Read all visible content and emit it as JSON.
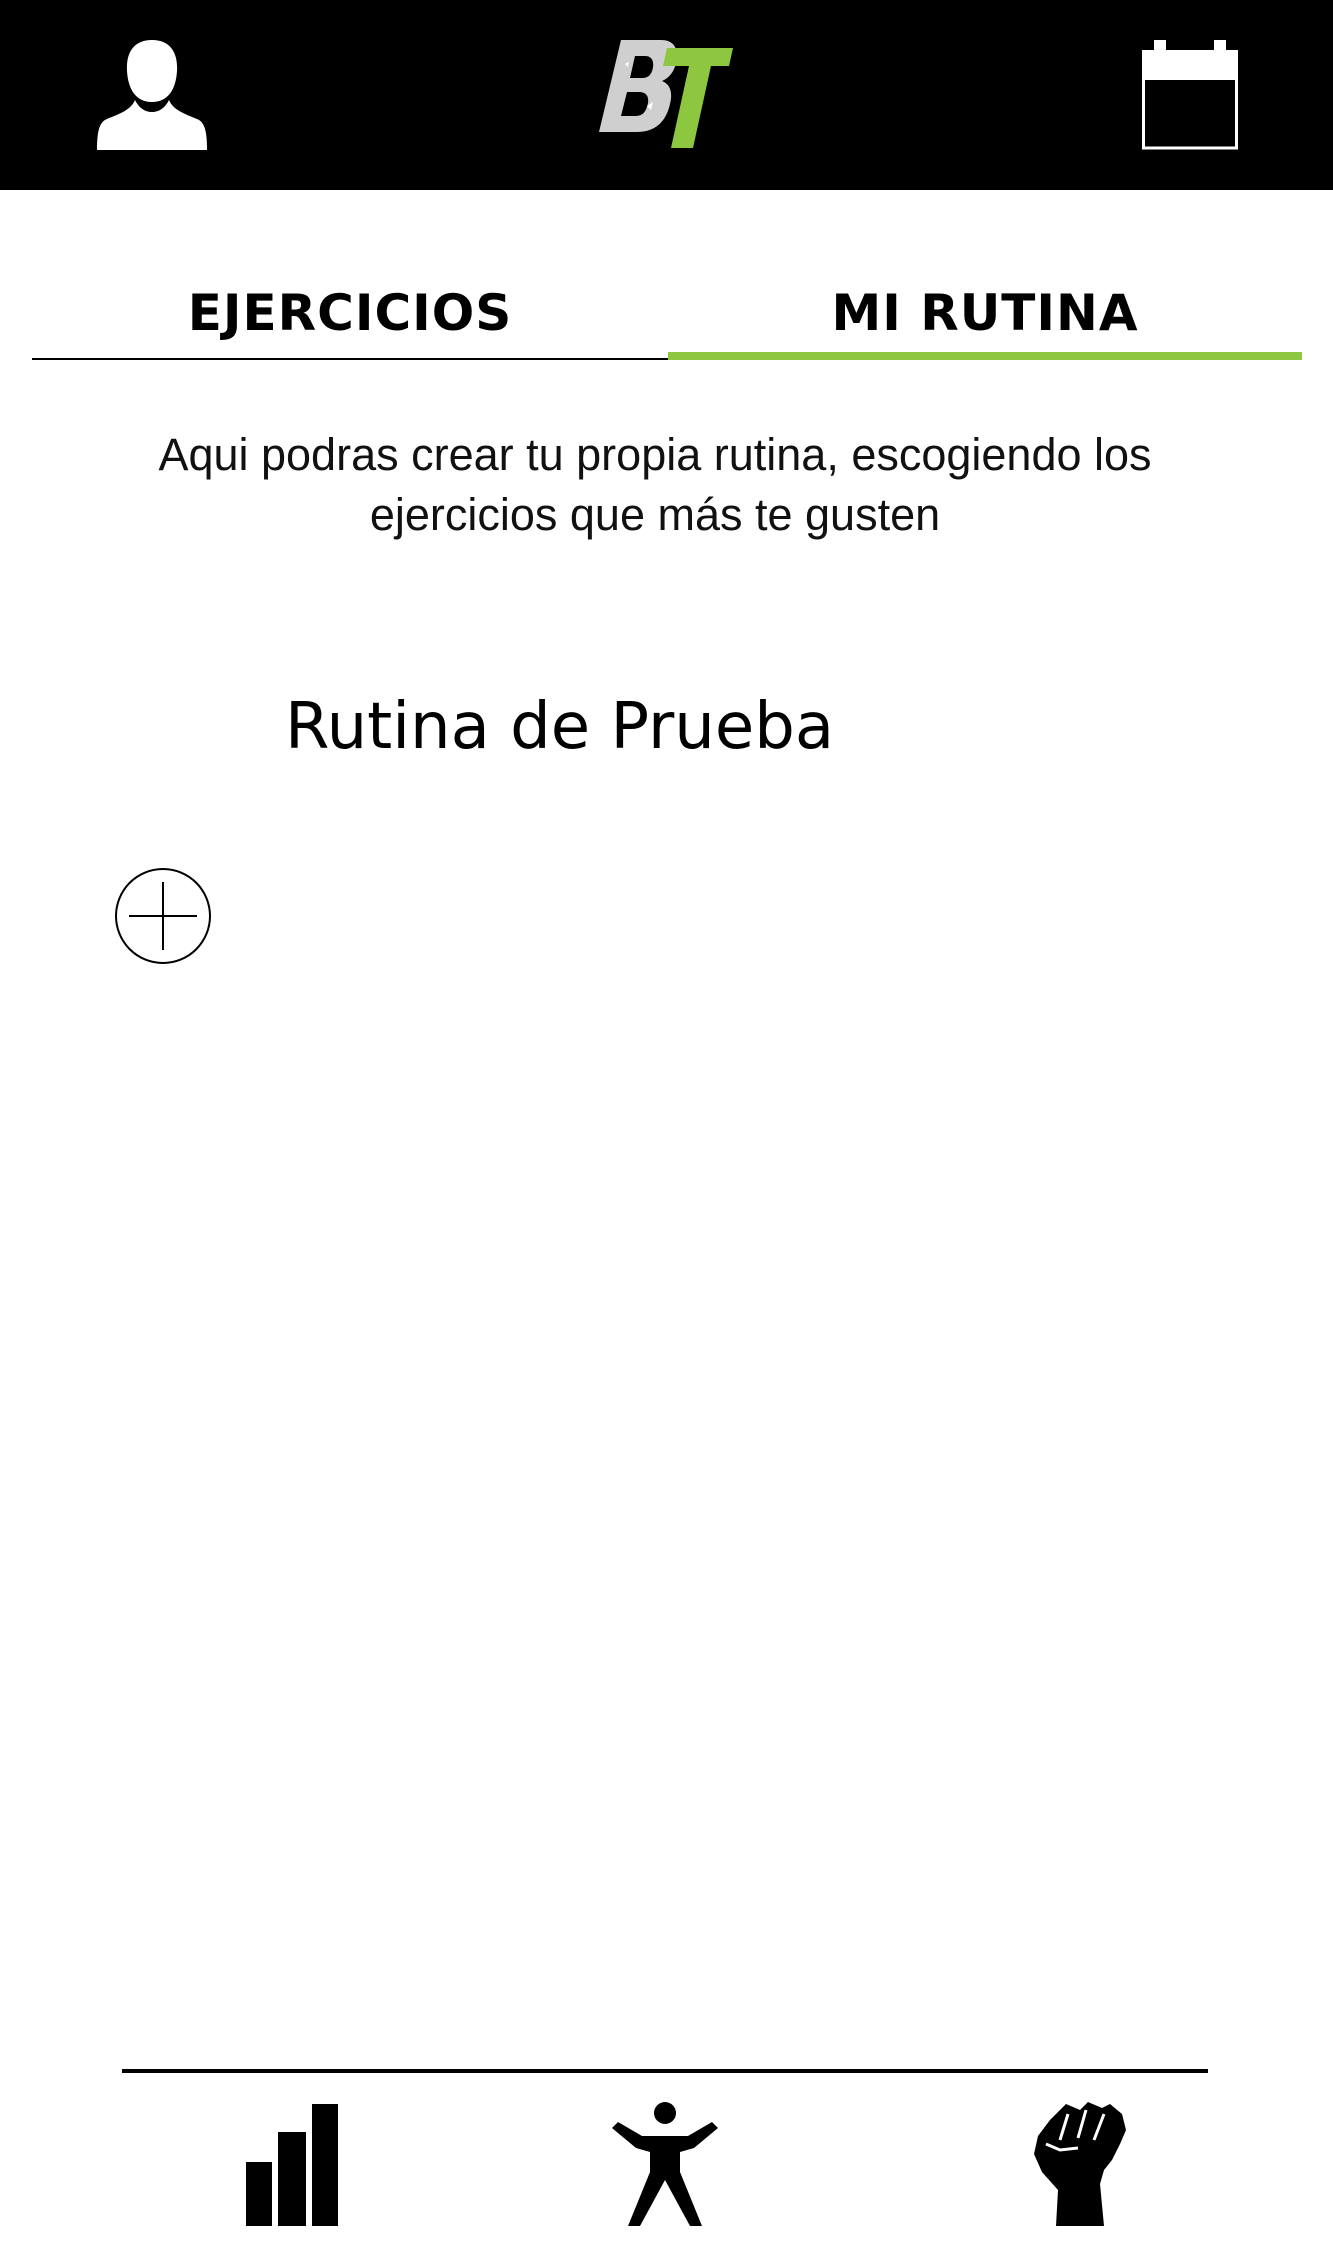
{
  "header": {
    "profile_icon": "person-icon",
    "logo_text": "BT",
    "calendar_icon": "calendar-icon"
  },
  "tabs": [
    {
      "label": "EJERCICIOS",
      "active": false
    },
    {
      "label": "MI RUTINA",
      "active": true
    }
  ],
  "colors": {
    "accent": "#8dc63f",
    "header_bg": "#000000",
    "logo_grey": "#cfcfcf"
  },
  "description": "Aqui podras crear tu propia rutina, escogiendo los ejercicios que más te gusten",
  "routine": {
    "name": "Rutina de Prueba"
  },
  "add_button_icon": "plus-circle-icon",
  "bottom_nav": [
    {
      "icon": "bar-chart-icon"
    },
    {
      "icon": "person-exercise-icon"
    },
    {
      "icon": "raised-fist-icon"
    }
  ]
}
